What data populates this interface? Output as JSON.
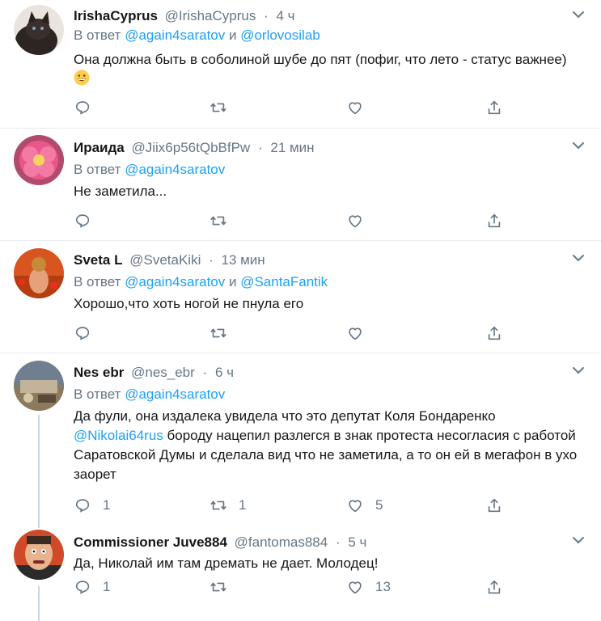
{
  "tweets": [
    {
      "name": "IrishaCyprus",
      "handle": "@IrishaCyprus",
      "time": "4 ч",
      "reply_prefix": "В ответ",
      "mention1": "@again4saratov",
      "connector": " и ",
      "mention2": "@orlovosilab",
      "text": "Она должна быть в соболиной шубе до пят (пофиг, что лето - статус важнее)",
      "emoji": "grinning-face-emoji",
      "counts": {
        "reply": "",
        "retweet": "",
        "like": ""
      }
    },
    {
      "name": "Ираида",
      "handle": "@Jiix6p56tQbBfPw",
      "time": "21 мин",
      "reply_prefix": "В ответ",
      "mention1": "@again4saratov",
      "text": "Не заметила...",
      "counts": {
        "reply": "",
        "retweet": "",
        "like": ""
      }
    },
    {
      "name": "Sveta L",
      "handle": "@SvetaKiki",
      "time": "13 мин",
      "reply_prefix": "В ответ",
      "mention1": "@again4saratov",
      "connector": " и ",
      "mention2": "@SantaFantik",
      "text": "Хорошо,что хоть ногой не пнула его",
      "counts": {
        "reply": "",
        "retweet": "",
        "like": ""
      }
    },
    {
      "name": "Nes ebr",
      "handle": "@nes_ebr",
      "time": "6 ч",
      "reply_prefix": "В ответ",
      "mention1": "@again4saratov",
      "text_line1": "Да фули, она издалека увидела что это депутат Коля Бондаренко",
      "text_mention": "@Nikolai64rus",
      "text_rest": " бороду нацепил разлегся в знак протеста несогласия с работой Саратовской Думы и сделала вид что не заметила, а то он ей в мегафон в ухо заорет",
      "counts": {
        "reply": "1",
        "retweet": "1",
        "like": "5"
      }
    },
    {
      "name": "Commissioner Juve884",
      "handle": "@fantomas884",
      "time": "5 ч",
      "text": "Да, Николай им там дремать не дает. Молодец!",
      "counts": {
        "reply": "1",
        "retweet": "",
        "like": "13"
      }
    }
  ],
  "colors": {
    "accent": "#1da1f2",
    "muted": "#657786",
    "divider": "#e6ecf0"
  }
}
